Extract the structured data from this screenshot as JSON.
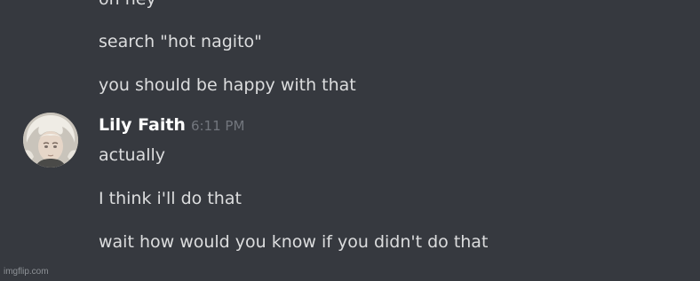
{
  "messages": {
    "prev_group": [
      "oh hey",
      "search \"hot nagito\"",
      "you should be happy with that"
    ],
    "group": {
      "author": "Lily Faith",
      "timestamp": "6:11 PM",
      "lines": [
        "actually",
        "I think i'll do that",
        "wait how would you know if you didn't do that"
      ]
    }
  },
  "watermark": "imgflip.com",
  "colors": {
    "background": "#36393f",
    "message_text": "#dcddde",
    "author_name": "#ffffff",
    "timestamp": "#72767d"
  }
}
